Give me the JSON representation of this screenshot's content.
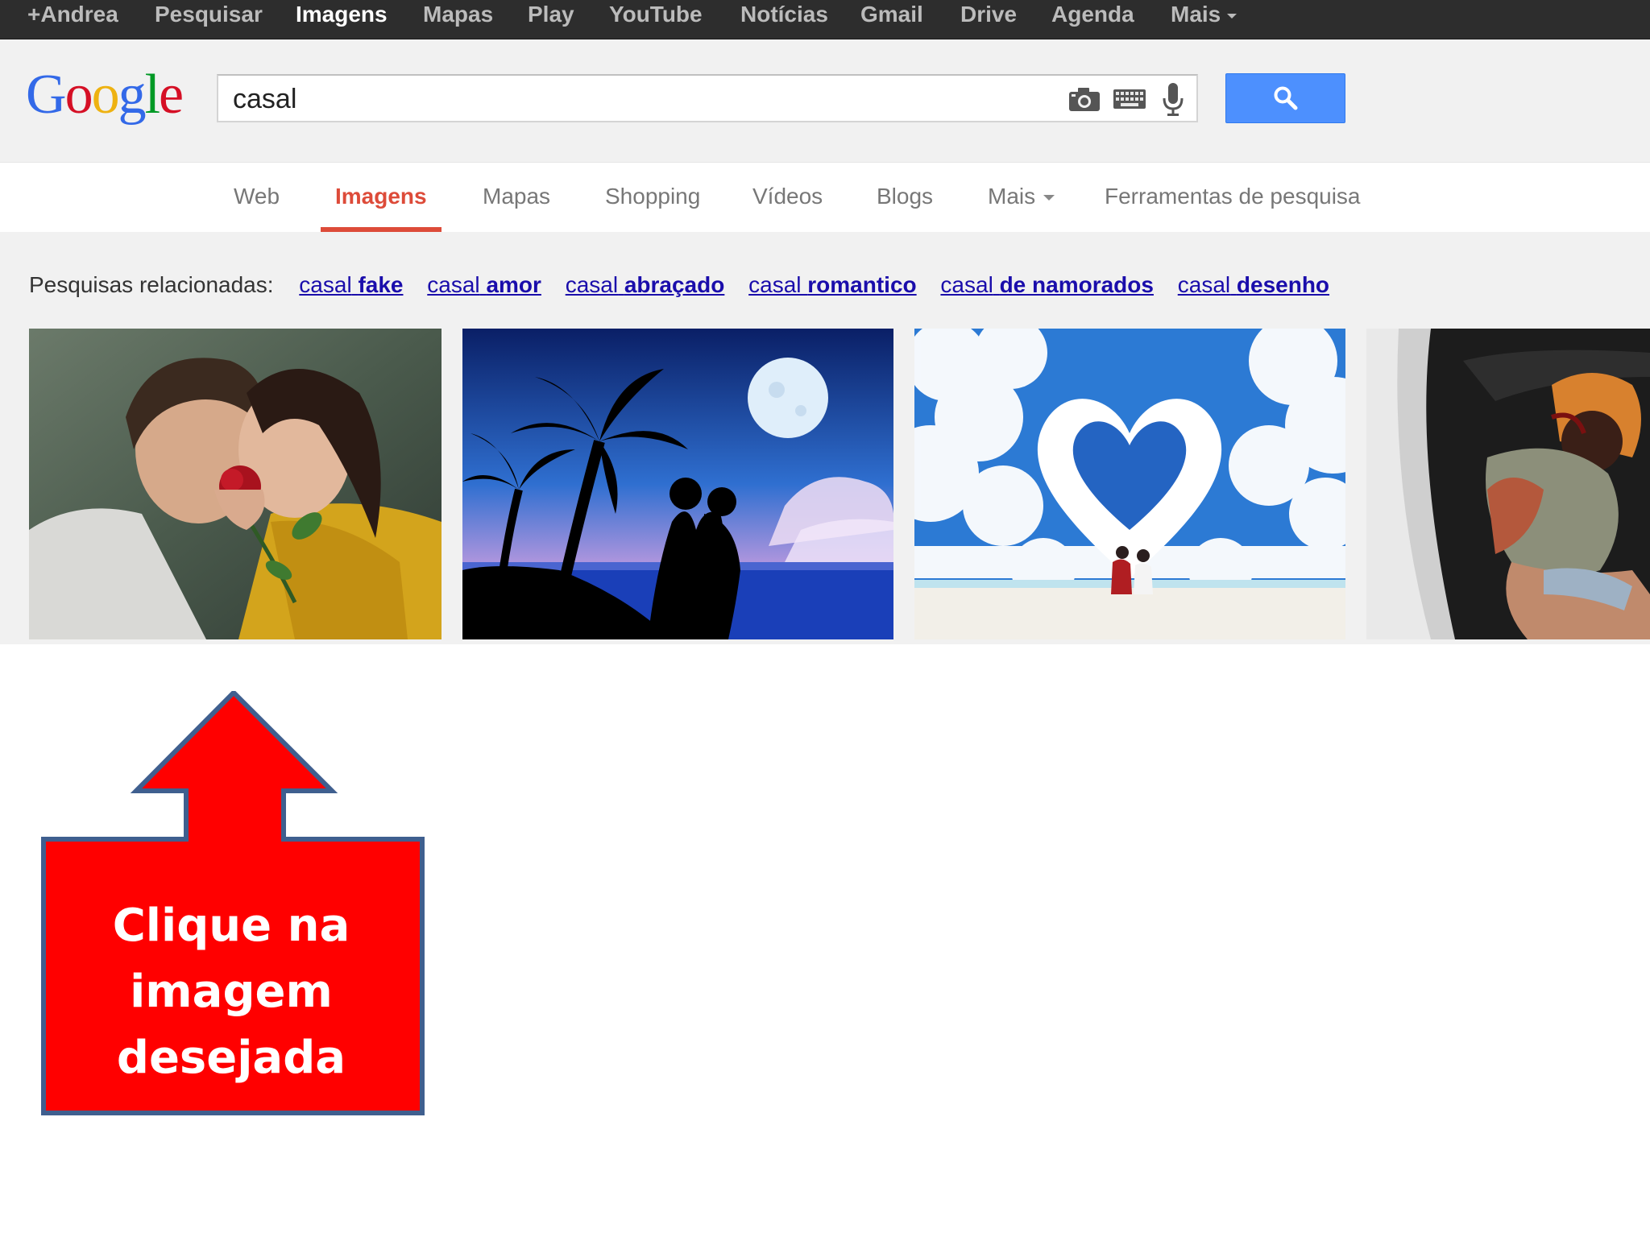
{
  "topbar": {
    "items": [
      "+Andrea",
      "Pesquisar",
      "Imagens",
      "Mapas",
      "Play",
      "YouTube",
      "Notícias",
      "Gmail",
      "Drive",
      "Agenda"
    ],
    "more": "Mais"
  },
  "logo": {
    "letters": [
      "G",
      "o",
      "o",
      "g",
      "l",
      "e"
    ],
    "colors": [
      "#3369e8",
      "#d50f25",
      "#eeb211",
      "#3369e8",
      "#009925",
      "#d50f25"
    ]
  },
  "search": {
    "query": "casal",
    "button_color": "#4d90fe"
  },
  "tabs": {
    "items": [
      "Web",
      "Imagens",
      "Mapas",
      "Shopping",
      "Vídeos",
      "Blogs",
      "Mais",
      "Ferramentas de pesquisa"
    ],
    "active_color": "#dd4b39"
  },
  "related": {
    "label": "Pesquisas relacionadas:",
    "links": [
      {
        "prefix": "casal",
        "suffix": "fake"
      },
      {
        "prefix": "casal",
        "suffix": "amor"
      },
      {
        "prefix": "casal",
        "suffix": "abraçado"
      },
      {
        "prefix": "casal",
        "suffix": "romantico"
      },
      {
        "prefix": "casal",
        "suffix": "de namorados"
      },
      {
        "prefix": "casal",
        "suffix": "desenho"
      }
    ]
  },
  "callout": {
    "lines": [
      "Clique na",
      "imagem",
      "desejada"
    ],
    "fill": "#ff0000",
    "stroke": "#3f5f8f"
  }
}
